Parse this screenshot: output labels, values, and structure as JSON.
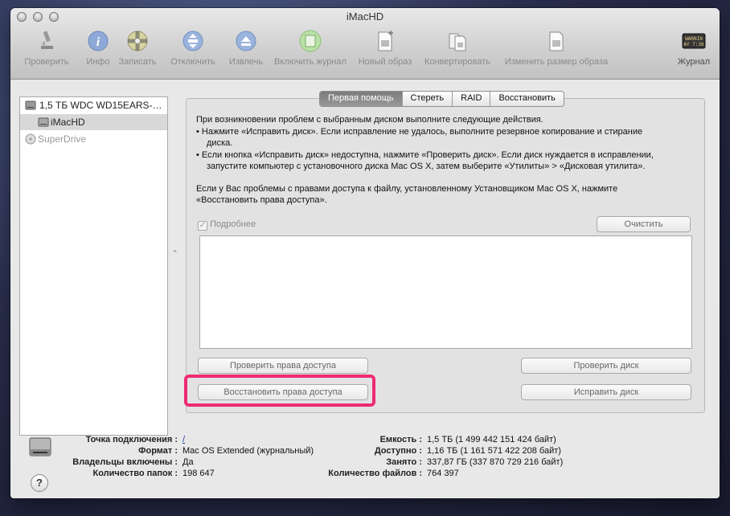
{
  "window": {
    "title": "iMacHD"
  },
  "toolbar": {
    "verify": "Проверить",
    "info": "Инфо",
    "burn": "Записать",
    "unmount": "Отключить",
    "eject": "Извлечь",
    "enable_journaling": "Включить журнал",
    "new_image": "Новый образ",
    "convert": "Конвертировать",
    "resize_image": "Изменить размер образа",
    "log": "Журнал",
    "log_icon_text_1": "WARNIN",
    "log_icon_text_2": "AY 7:36"
  },
  "sidebar": {
    "items": [
      {
        "label": "1,5 ТБ WDC WD15EARS-…",
        "icon": "hard-disk-icon"
      },
      {
        "label": "iMacHD",
        "icon": "volume-icon"
      },
      {
        "label": "SuperDrive",
        "icon": "optical-drive-icon"
      }
    ]
  },
  "tabs": [
    "Первая помощь",
    "Стереть",
    "RAID",
    "Восстановить"
  ],
  "first_aid": {
    "intro": "При возникновении проблем с выбранным диском выполните следующие действия.",
    "bullet1_line1": "• Нажмите «Исправить диск». Если исправление не удалось, выполните резервное копирование и стирание",
    "bullet1_line2": "диска.",
    "bullet2_line1": "• Если кнопка «Исправить диск» недоступна, нажмите «Проверить диск». Если диск нуждается в исправлении,",
    "bullet2_line2": "запустите компьютер с установочного диска Mac OS X, затем выберите «Утилиты» > «Дисковая утилита».",
    "perm_line1": "Если у Вас проблемы с правами доступа к файлу, установленному Установщиком Mac OS X, нажмите",
    "perm_line2": "«Восстановить права доступа».",
    "details_label": "Подробнее",
    "details_checked": true,
    "clear_button": "Очистить",
    "verify_permissions": "Проверить права доступа",
    "repair_permissions": "Восстановить права доступа",
    "verify_disk": "Проверить диск",
    "repair_disk": "Исправить диск"
  },
  "info": {
    "left": [
      {
        "key": "Точка подключения :",
        "value": "/"
      },
      {
        "key": "Формат :",
        "value": "Mac OS Extended (журнальный)"
      },
      {
        "key": "Владельцы включены :",
        "value": "Да"
      },
      {
        "key": "Количество папок :",
        "value": "198 647"
      }
    ],
    "right": [
      {
        "key": "Емкость :",
        "value": "1,5 ТБ (1 499 442 151 424 байт)"
      },
      {
        "key": "Доступно :",
        "value": "1,16 ТБ (1 161 571 422 208 байт)"
      },
      {
        "key": "Занято :",
        "value": "337,87 ГБ (337 870 729 216 байт)"
      },
      {
        "key": "Количество файлов :",
        "value": "764 397"
      }
    ]
  },
  "help_button": "?",
  "colors": {
    "highlight": "#ee2a73",
    "selected_tab": "#8a8a8a",
    "selection_row": "#d8d8d8"
  }
}
